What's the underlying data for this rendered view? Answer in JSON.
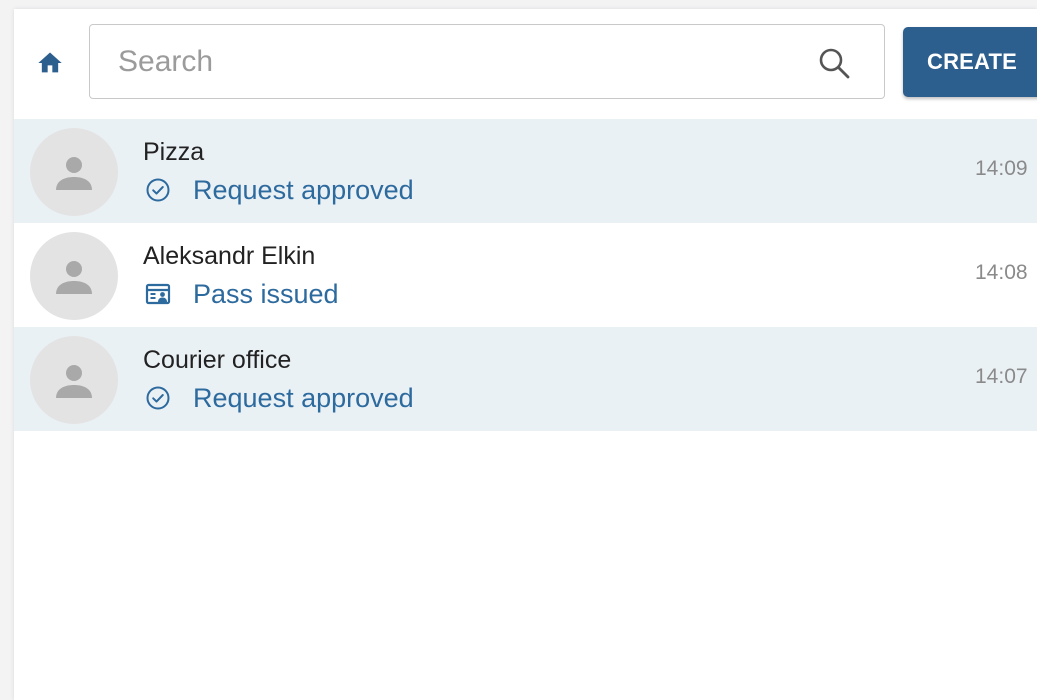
{
  "toolbar": {
    "home_icon": "home-icon",
    "search_placeholder": "Search",
    "search_value": "",
    "search_icon": "search-icon",
    "create_label": "CREATE"
  },
  "colors": {
    "accent": "#2d5f8e",
    "status_text": "#2d6a9e",
    "row_highlight": "#eaf1f5",
    "avatar_bg": "#e3e3e3"
  },
  "items": [
    {
      "name": "Pizza",
      "status": "Request approved",
      "status_icon": "check-circle-icon",
      "time": "14:09",
      "highlighted": true
    },
    {
      "name": "Aleksandr Elkin",
      "status": "Pass issued",
      "status_icon": "id-card-icon",
      "time": "14:08",
      "highlighted": false
    },
    {
      "name": "Courier office",
      "status": "Request approved",
      "status_icon": "check-circle-icon",
      "time": "14:07",
      "highlighted": true
    }
  ]
}
